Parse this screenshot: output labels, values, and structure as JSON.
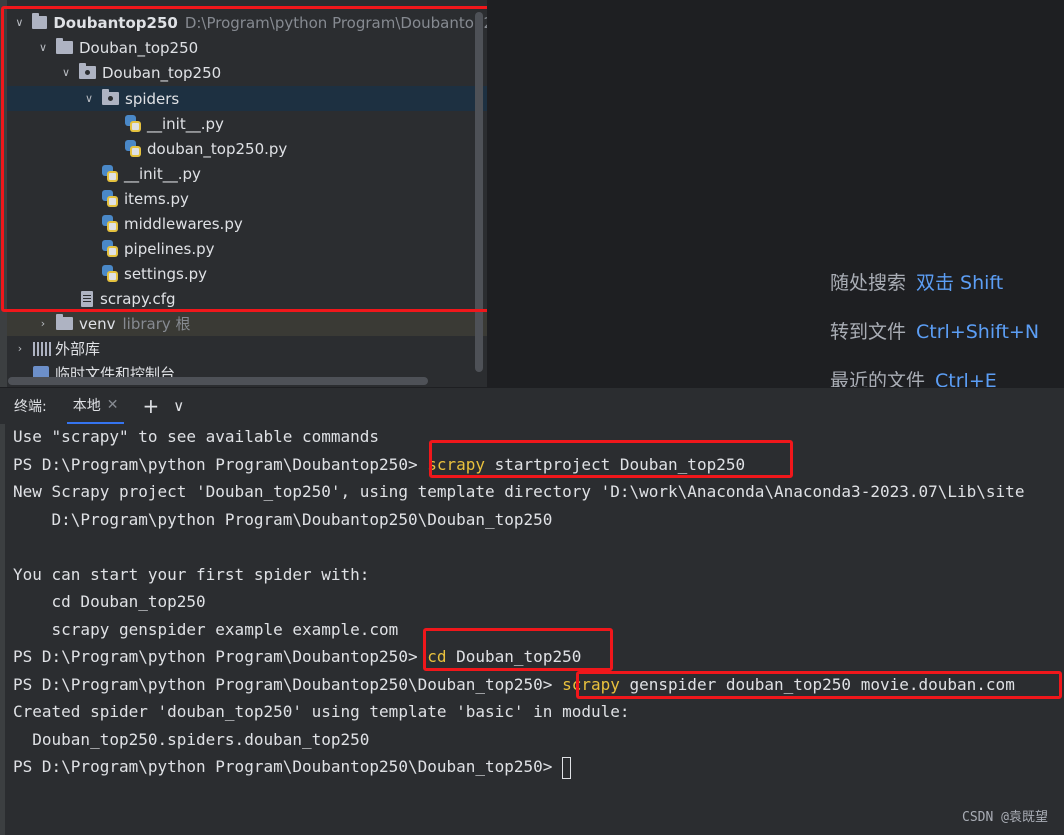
{
  "project_tree": {
    "root": {
      "name": "Doubantop250",
      "path": "D:\\Program\\python Program\\Doubantop2"
    },
    "items": [
      {
        "label": "Douban_top250",
        "type": "folder"
      },
      {
        "label": "Douban_top250",
        "type": "package"
      },
      {
        "label": "spiders",
        "type": "package"
      },
      {
        "label": "__init__.py",
        "type": "python"
      },
      {
        "label": "douban_top250.py",
        "type": "python"
      },
      {
        "label": "__init__.py",
        "type": "python"
      },
      {
        "label": "items.py",
        "type": "python"
      },
      {
        "label": "middlewares.py",
        "type": "python"
      },
      {
        "label": "pipelines.py",
        "type": "python"
      },
      {
        "label": "settings.py",
        "type": "python"
      },
      {
        "label": "scrapy.cfg",
        "type": "config"
      }
    ],
    "venv": {
      "label": "venv",
      "hint": "library 根"
    },
    "external_libs": "外部库",
    "scratches": "临时文件和控制台"
  },
  "editor_hints": [
    {
      "label": "随处搜索",
      "key": "双击 Shift"
    },
    {
      "label": "转到文件",
      "key": "Ctrl+Shift+N"
    },
    {
      "label": "最近的文件",
      "key": "Ctrl+E"
    }
  ],
  "terminal": {
    "title": "终端:",
    "tab_label": "本地",
    "add_symbol": "+",
    "lines": {
      "l1": "Use \"scrapy\" to see available commands",
      "l2_prompt": "PS D:\\Program\\python Program\\Doubantop250> ",
      "l2_kw": "scrapy",
      "l2_rest": " startproject Douban_top250",
      "l3": "New Scrapy project 'Douban_top250', using template directory 'D:\\work\\Anaconda\\Anaconda3-2023.07\\Lib\\site",
      "l4": "    D:\\Program\\python Program\\Doubantop250\\Douban_top250",
      "l5": "You can start your first spider with:",
      "l6": "    cd Douban_top250",
      "l7": "    scrapy genspider example example.com",
      "l8_prompt": "PS D:\\Program\\python Program\\Doubantop250> ",
      "l8_kw": "cd",
      "l8_rest": " Douban_top250",
      "l9_prompt": "PS D:\\Program\\python Program\\Doubantop250\\Douban_top250> ",
      "l9_kw": "scrapy",
      "l9_rest": " genspider douban_top250 movie.douban.com",
      "l10": "Created spider 'douban_top250' using template 'basic' in module:",
      "l11": "  Douban_top250.spiders.douban_top250",
      "l12_prompt": "PS D:\\Program\\python Program\\Doubantop250\\Douban_top250> "
    }
  },
  "watermark": "CSDN @袁既望",
  "colors": {
    "highlight_box": "#f0171b",
    "command_keyword": "#e9c13d",
    "key_hint": "#5c9ef5",
    "selection": "#1d3041"
  }
}
